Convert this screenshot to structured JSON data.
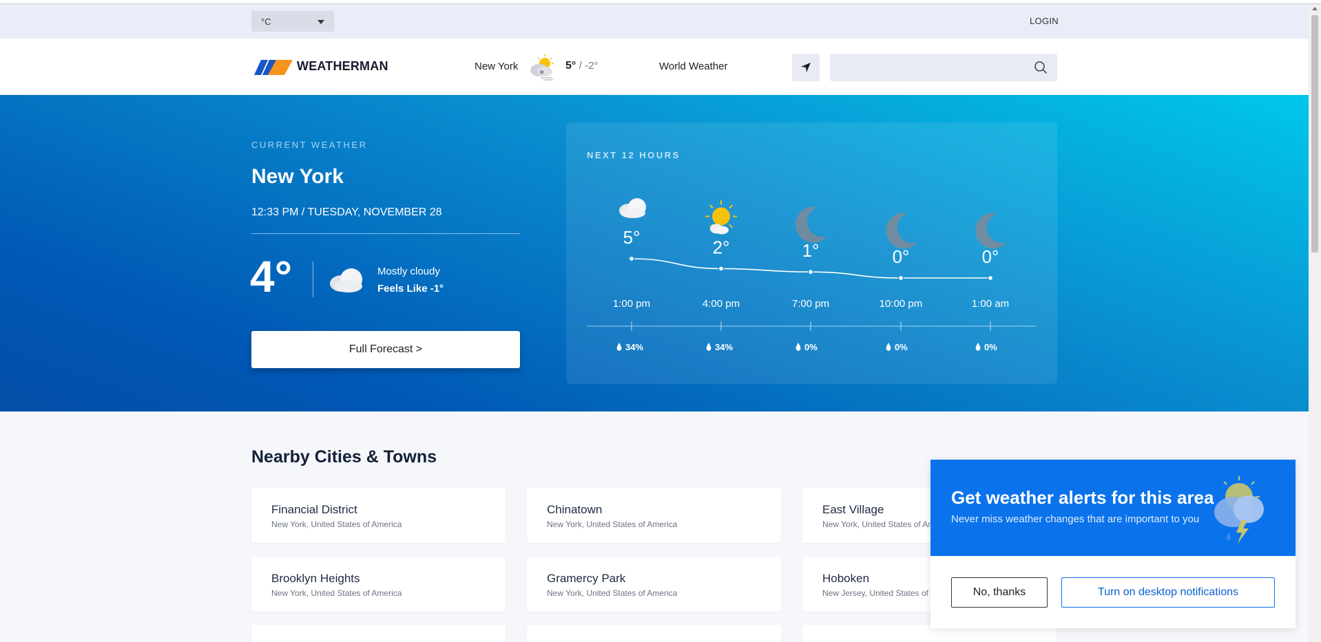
{
  "utility": {
    "unit": "°C",
    "login": "LOGIN"
  },
  "header": {
    "brand": "WEATHERMAN",
    "city": "New York",
    "high": "5°",
    "low": "/ -2°",
    "world": "World Weather",
    "search_placeholder": ""
  },
  "current": {
    "label": "CURRENT WEATHER",
    "city": "New York",
    "datetime": "12:33 PM / TUESDAY, NOVEMBER 28",
    "temp": "4°",
    "condition": "Mostly cloudy",
    "feels_like": "Feels Like -1°",
    "forecast_button": "Full Forecast >"
  },
  "hourly": {
    "label": "NEXT 12 HOURS",
    "hours": [
      {
        "time": "1:00 pm",
        "temp": 5,
        "temp_label": "5°",
        "precip": "34%",
        "icon": "cloud-icon"
      },
      {
        "time": "4:00 pm",
        "temp": 2,
        "temp_label": "2°",
        "precip": "34%",
        "icon": "sun-cloud-icon"
      },
      {
        "time": "7:00 pm",
        "temp": 1,
        "temp_label": "1°",
        "precip": "0%",
        "icon": "moon-icon"
      },
      {
        "time": "10:00 pm",
        "temp": 0,
        "temp_label": "0°",
        "precip": "0%",
        "icon": "moon-icon"
      },
      {
        "time": "1:00 am",
        "temp": 0,
        "temp_label": "0°",
        "precip": "0%",
        "icon": "moon-icon"
      }
    ]
  },
  "nearby": {
    "title": "Nearby Cities & Towns",
    "cities": [
      {
        "name": "Financial District",
        "region": "New York, United States of America"
      },
      {
        "name": "Chinatown",
        "region": "New York, United States of America"
      },
      {
        "name": "East Village",
        "region": "New York, United States of America"
      },
      {
        "name": "Brooklyn Heights",
        "region": "New York, United States of America"
      },
      {
        "name": "Gramercy Park",
        "region": "New York, United States of America"
      },
      {
        "name": "Hoboken",
        "region": "New Jersey, United States of America"
      }
    ]
  },
  "alert": {
    "title": "Get weather alerts for this area",
    "subtitle": "Never miss weather changes that are important to you",
    "decline": "No, thanks",
    "accept": "Turn on desktop notifications"
  },
  "colors": {
    "brand_blue": "#0a73ec",
    "logo_orange": "#f7941d",
    "logo_blue": "#1a56c8",
    "sun": "#f6c20d"
  }
}
